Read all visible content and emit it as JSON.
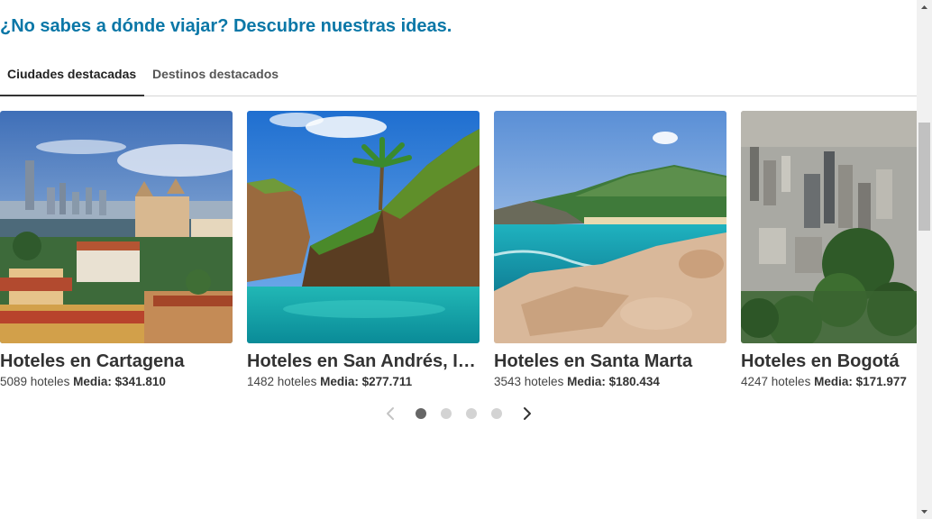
{
  "heading": "¿No sabes a dónde viajar? Descubre nuestras ideas.",
  "tabs": [
    {
      "label": "Ciudades destacadas",
      "active": true
    },
    {
      "label": "Destinos destacados",
      "active": false
    }
  ],
  "cards": [
    {
      "title": "Hoteles en Cartagena",
      "count": "5089 hoteles",
      "avg_label": "Media:",
      "avg_value": "$341.810"
    },
    {
      "title": "Hoteles en San Andrés, Isla de San Andrés",
      "count": "1482 hoteles",
      "avg_label": "Media:",
      "avg_value": "$277.711"
    },
    {
      "title": "Hoteles en Santa Marta",
      "count": "3543 hoteles",
      "avg_label": "Media:",
      "avg_value": "$180.434"
    },
    {
      "title": "Hoteles en Bogotá",
      "count": "4247 hoteles",
      "avg_label": "Media:",
      "avg_value": "$171.977"
    }
  ],
  "pager": {
    "pages": 4,
    "current": 1
  },
  "colors": {
    "heading": "#0a77a7",
    "dot_active": "#666666",
    "dot_inactive": "#d3d3d3"
  }
}
